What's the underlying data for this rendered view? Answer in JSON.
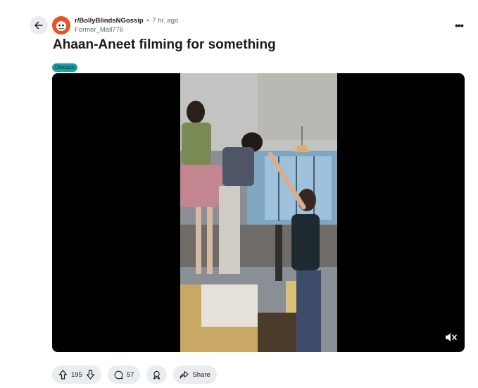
{
  "post": {
    "subreddit": "r/BollyBlindsNGossip",
    "separator": "•",
    "time_ago": "7 hr. ago",
    "author": "Former_Mall776",
    "title": "Ahaan-Aneet filming for something",
    "flair": "Discuss",
    "more_label": "•••"
  },
  "actions": {
    "upvotes": "195",
    "comments": "57",
    "share_label": "Share"
  },
  "icons": {
    "back": "back-arrow-icon",
    "avatar": "subreddit-avatar",
    "more": "more-options-icon",
    "upvote": "upvote-arrow-icon",
    "downvote": "downvote-arrow-icon",
    "comment": "comment-bubble-icon",
    "award": "award-icon",
    "share": "share-icon",
    "mute": "muted-speaker-icon"
  },
  "colors": {
    "flair_bg": "#1a9ea5",
    "avatar_bg": "#e8522a",
    "pill_bg": "#eaedef"
  }
}
